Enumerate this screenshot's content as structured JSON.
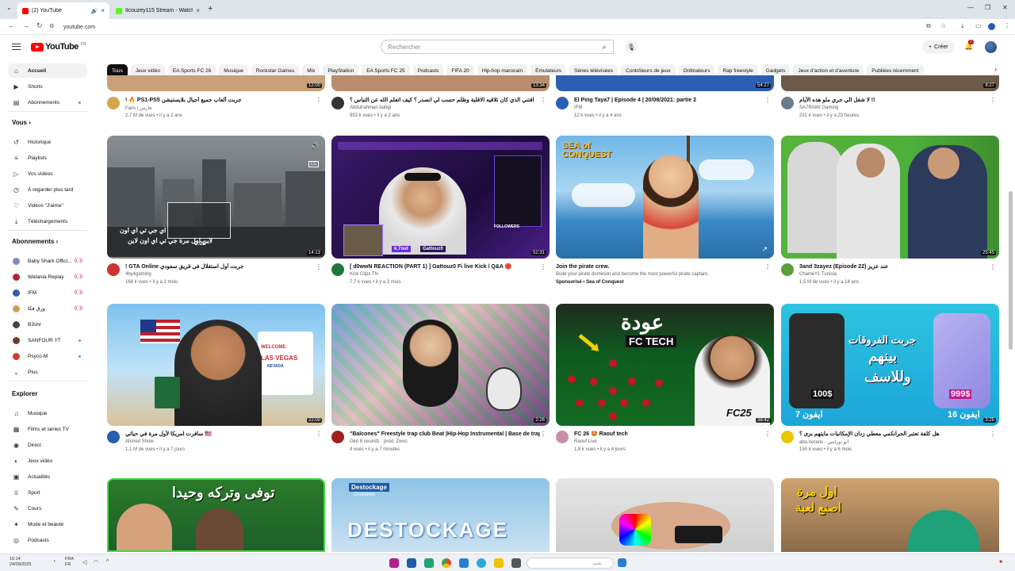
{
  "browser": {
    "tabs": [
      {
        "title": "(2) YouTube",
        "active": true
      },
      {
        "title": "Ilcouzey115 Stream - Watch Li...",
        "active": false
      }
    ],
    "new_tab": "+",
    "url": "youtube.com"
  },
  "masthead": {
    "logo_text": "YouTube",
    "logo_region": "FR",
    "search_placeholder": "Rechercher",
    "create_label": "Créer",
    "notif_count": "2"
  },
  "sidebar": {
    "main": [
      {
        "label": "Accueil",
        "icon": "home-icon",
        "glyph": "⌂",
        "active": true
      },
      {
        "label": "Shorts",
        "icon": "shorts-icon",
        "glyph": "▶"
      },
      {
        "label": "Abonnements",
        "icon": "subscriptions-icon",
        "glyph": "▤"
      }
    ],
    "you_heading": "Vous",
    "you": [
      {
        "label": "Historique",
        "icon": "history-icon",
        "glyph": "↺"
      },
      {
        "label": "Playlists",
        "icon": "playlists-icon",
        "glyph": "≡"
      },
      {
        "label": "Vos vidéos",
        "icon": "your-videos-icon",
        "glyph": "▷"
      },
      {
        "label": "À regarder plus tard",
        "icon": "watch-later-icon",
        "glyph": "◷"
      },
      {
        "label": "Vidéos \"J'aime\"",
        "icon": "liked-videos-icon",
        "glyph": "♡"
      },
      {
        "label": "Téléchargements",
        "icon": "downloads-icon",
        "glyph": "⤓"
      }
    ],
    "subs_heading": "Abonnements",
    "subs": [
      {
        "label": "Baby Shark Offici...",
        "color": "#7b8cc7",
        "mark": "live"
      },
      {
        "label": "Watania Replay",
        "color": "#b0282d",
        "mark": "live"
      },
      {
        "label": "IFM",
        "color": "#2b5fb3",
        "mark": "live"
      },
      {
        "label": "ورق فكا",
        "color": "#c8a15a",
        "mark": "live"
      },
      {
        "label": "B3shr",
        "color": "#444",
        "mark": ""
      },
      {
        "label": "SANFOUR YT",
        "color": "#6a3e2a",
        "mark": "dot"
      },
      {
        "label": "Psyco-M",
        "color": "#d13b2e",
        "mark": "dot"
      },
      {
        "label": "Plus",
        "color": "",
        "mark": ""
      }
    ],
    "explore_heading": "Explorer",
    "explore": [
      {
        "label": "Musique",
        "icon": "music-icon",
        "glyph": "♫"
      },
      {
        "label": "Films et séries TV",
        "icon": "films-icon",
        "glyph": "▦"
      },
      {
        "label": "Direct",
        "icon": "live-icon",
        "glyph": "◉"
      },
      {
        "label": "Jeux vidéo",
        "icon": "gaming-icon",
        "glyph": "◐"
      },
      {
        "label": "Actualités",
        "icon": "news-icon",
        "glyph": "▣"
      },
      {
        "label": "Sport",
        "icon": "sport-icon",
        "glyph": "♕"
      },
      {
        "label": "Cours",
        "icon": "courses-icon",
        "glyph": "✎"
      },
      {
        "label": "Mode et beauté",
        "icon": "fashion-icon",
        "glyph": "✦"
      },
      {
        "label": "Podcasts",
        "icon": "podcasts-icon",
        "glyph": "◎"
      }
    ]
  },
  "chips": [
    "Tous",
    "Jeux vidéo",
    "EA Sports FC 26",
    "Musique",
    "Rockstar Games",
    "Mix",
    "PlayStation",
    "EA Sports FC 25",
    "Podcasts",
    "FIFA 20",
    "Hip-hop marocain",
    "Émulateurs",
    "Séries télévisées",
    "Contrôleurs de jeux",
    "Ordinateurs",
    "Rap freestyle",
    "Gadgets",
    "Jeux d'action et d'aventure",
    "Publiées récemment"
  ],
  "videos_row0": [
    {
      "title": "! 🔥 PS1-PS5 جربت ألعاب جميع أجيال بلايستيشن",
      "channel": "Faris | فارس",
      "views": "2,7 M de vues • il y a 2 ans",
      "duration": "12:00",
      "ch_color": "#d4a84a"
    },
    {
      "title": "اقتني الذي كان تلاقيه الاقلية وظلم حسب لي انصدر ؟ كيف اتعلم الله عن التياس ؟",
      "channel": "Abdulrahman babgi",
      "views": "953 k vues • il y a 2 ans",
      "duration": "13:34",
      "ch_color": "#333"
    },
    {
      "title": "El Ping Taya7 | Episode 4 | 20/08/2021: partie 2",
      "channel": "IFM",
      "views": "12 k vues • il y a 4 ans",
      "duration": "54:27",
      "ch_color": "#2b5fb3"
    },
    {
      "title": "لا شغل الي جري ملو هذه الأيام !!",
      "channel": "SA7RAWI Gaming",
      "views": "231 k vues • il y a 23 heures",
      "duration": "8:27",
      "ch_color": "#6a7b8a"
    }
  ],
  "videos_row1": [
    {
      "title": "! GTA Online جربت أول استغلال في قريق سعودي",
      "channel": "4by4gaming",
      "views": "168 k vues • il y a 1 mois",
      "duration": "14:13",
      "ch_color": "#c33",
      "preview_time": "0:02"
    },
    {
      "title": "[ d0wwN REACTION (PART 1) ] Gattouz0 Fi live Kick / Q&A 🔴",
      "channel": "Kick Clips TN",
      "views": "7,7 k vues • il y a 3 mois",
      "duration": "52:31",
      "ch_color": "#1f7a3a"
    },
    {
      "title": "Join the pirate crew.",
      "channel": "Build your pirate dominion and become the most powerful pirate captain.",
      "views": "Sponsorisé • Sea of Conquest",
      "duration": "",
      "ch_color": ""
    },
    {
      "title": "3and 3zayez (Episode 22) عند عزيز",
      "channel": "ChaineY1 Tunisia",
      "views": "1,5 M de vues • il y a 14 ans",
      "duration": "25:45",
      "ch_color": "#5c9e3a"
    }
  ],
  "videos_row2": [
    {
      "title": "سافرت امريكا لأول مرة في حياتي 🇺🇸",
      "channel": "Ahmed Show",
      "views": "1,1 M de vues • il y a 7 jours",
      "duration": "22:00",
      "ch_color": "#2a5db0"
    },
    {
      "title": "\"Balcones\" Freestyle trap club Beat |Hip-Hop Instrumental | Base de trap club /prod Zwes",
      "channel": "Oké 8 recordz · prod. Zwes",
      "views": "4 vues • il y a 7 minutes",
      "duration": "2:26",
      "ch_color": "#a02020"
    },
    {
      "title": "FC 26 🤩 Raouf tech",
      "channel": "Raouf Live",
      "views": "1,8 k vues • il y a 4 jours",
      "duration": "38:42",
      "ch_color": "#c58fa8"
    },
    {
      "title": "هل كلفة تعتبر الجرانكمي معطي زدان الإمكانيات مايتهم بزى ؟",
      "channel": "abo.noranv - ابو نورانس",
      "views": "150 k vues • il y a 6 mois",
      "duration": "3:25",
      "ch_color": "#e5c800"
    }
  ],
  "thumb_text": {
    "gta_sub": "لاين اول مرة جي تي اي اون لاين",
    "gta_sub2": "اي جي تي اي اون",
    "sea_logo": "SEA of CONQUEST",
    "vegas_welcome": "WELCOME",
    "vegas_name": "LAS VEGAS",
    "vegas_state": "NEVADA",
    "fctech_ar": "عودة",
    "fctech_en": "FC TECH",
    "fc25": "FC25",
    "iphone_ar1": "جربت الفروقات",
    "iphone_ar2": "بينهم",
    "iphone_ar3": "وللاسف",
    "price1": "100$",
    "price2": "999$",
    "iphone_label1": "ايفون 7",
    "iphone_label2": "ايفون 16",
    "row3_ar1": "توفى وتركه وحيدا",
    "destock_top": "Destockage",
    "destock_sub": "Croisières",
    "destock_big": "DESTOCKAGE",
    "row3_ar4a": "اول مرة",
    "row3_ar4b": "اصنع لعبة",
    "stream_badge": "k.7out",
    "stream_name": "Gattouz0",
    "followers": "FOLLOWERS"
  },
  "taskbar": {
    "time": "15:14",
    "date": "24/09/2025",
    "lang": "FRA",
    "lang2": "FR",
    "search_placeholder": "بحث"
  },
  "colors": {
    "yt_red": "#ff0000",
    "chip_active": "#0f0f0f",
    "chip_bg": "#f2f2f2"
  }
}
